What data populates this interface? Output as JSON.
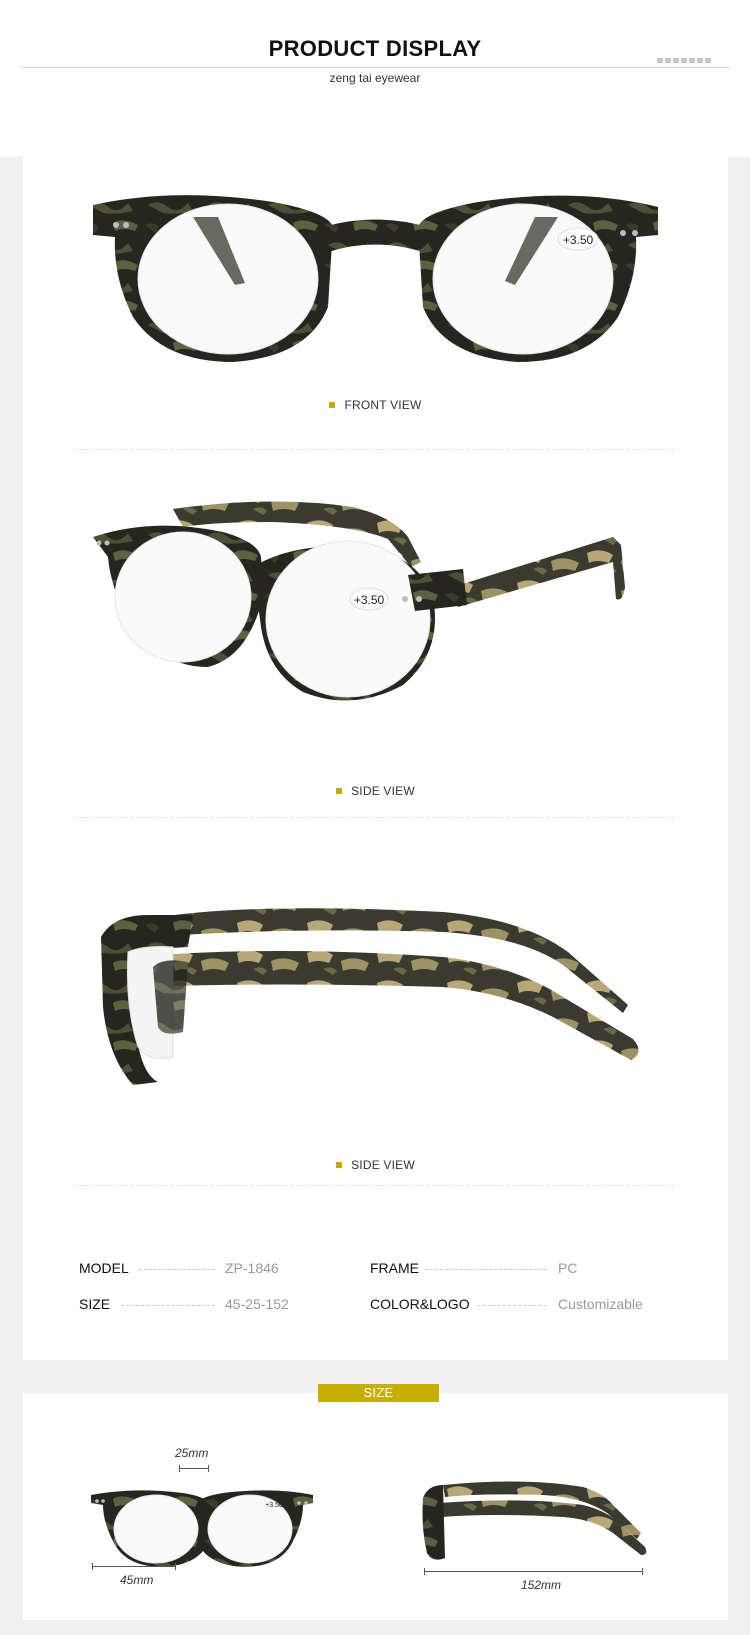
{
  "header": {
    "title": "PRODUCT DISPLAY",
    "subtitle": "zeng tai eyewear"
  },
  "views": [
    {
      "caption": "FRONT VIEW",
      "lens_label": "+3.50"
    },
    {
      "caption": "SIDE VIEW",
      "lens_label": "+3.50"
    },
    {
      "caption": "SIDE VIEW"
    }
  ],
  "specs": {
    "model_label": "MODEL",
    "model_value": "ZP-1846",
    "frame_label": "FRAME",
    "frame_value": "PC",
    "size_label": "SIZE",
    "size_value": "45-25-152",
    "color_label": "COLOR&LOGO",
    "color_value": "Customizable"
  },
  "size_section": {
    "badge": "SIZE",
    "bridge": "25mm",
    "lens_width": "45mm",
    "temple_length": "152mm",
    "mini_lens_label": "+3.50"
  },
  "colors": {
    "accent": "#c8ae00",
    "frame_dark": "#26261f",
    "tortoise_light": "#b8a878",
    "tortoise_green": "#4a5236"
  }
}
